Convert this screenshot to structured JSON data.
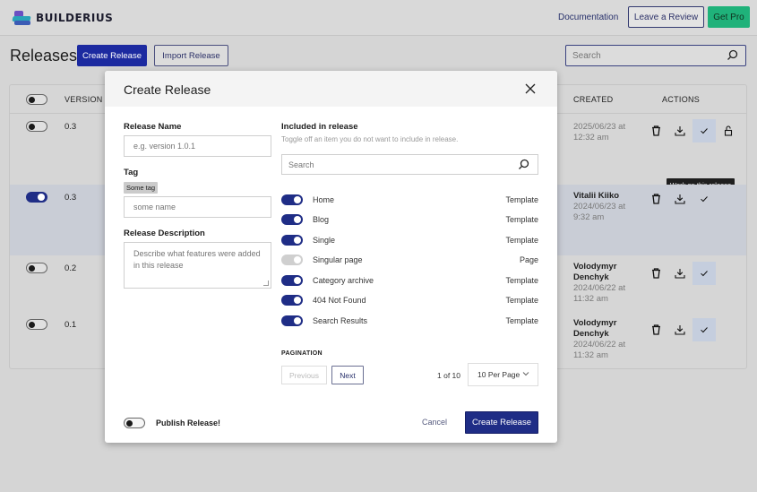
{
  "app": {
    "brand": "BUILDERIUS",
    "nav": {
      "documentation": "Documentation",
      "leave_review": "Leave a Review",
      "get_pro": "Get Pro"
    },
    "colors": {
      "primary": "#1c2aa0",
      "pro_green": "#1fb27a",
      "toggle_on": "#1f2d86"
    }
  },
  "page": {
    "title": "Releases",
    "create_release": "Create Release",
    "import_release": "Import Release",
    "search": {
      "placeholder": "Search",
      "value": ""
    }
  },
  "table": {
    "columns": {
      "version": "VERSION",
      "created": "CREATED",
      "actions": "ACTIONS"
    },
    "rows": [
      {
        "selected": false,
        "version": "0.3",
        "author": "",
        "created": "2025/06/23 at 12:32 am",
        "work_highlight": true,
        "locked_icon": true
      },
      {
        "selected": true,
        "version": "0.3",
        "author": "Vitalii Kiiko",
        "created": "2024/06/23 at 9:32 am",
        "work_highlight": false,
        "locked_icon": false
      },
      {
        "selected": false,
        "version": "0.2",
        "author": "Volodymyr Denchyk",
        "created": "2024/06/22 at 11:32 am",
        "work_highlight": true,
        "locked_icon": false
      },
      {
        "selected": false,
        "version": "0.1",
        "author": "Volodymyr Denchyk",
        "created": "2024/06/22 at 11:32 am",
        "work_highlight": true,
        "locked_icon": false
      }
    ],
    "tooltip": "Work on this release"
  },
  "modal": {
    "title": "Create Release",
    "release_name": {
      "label": "Release Name",
      "placeholder": "e.g. version 1.0.1",
      "value": ""
    },
    "tag": {
      "label": "Tag",
      "chip": "Some tag",
      "placeholder": "some name",
      "value": ""
    },
    "description": {
      "label": "Release Description",
      "placeholder": "Describe what features were added in this release",
      "value": ""
    },
    "included": {
      "label": "Included in release",
      "hint": "Toggle off an item you do not want to include in release.",
      "search_placeholder": "Search",
      "items": [
        {
          "name": "Home",
          "type": "Template",
          "enabled": true
        },
        {
          "name": "Blog",
          "type": "Template",
          "enabled": true
        },
        {
          "name": "Single",
          "type": "Template",
          "enabled": true
        },
        {
          "name": "Singular page",
          "type": "Page",
          "enabled": false
        },
        {
          "name": "Category archive",
          "type": "Template",
          "enabled": true
        },
        {
          "name": "404 Not Found",
          "type": "Template",
          "enabled": true
        },
        {
          "name": "Search Results",
          "type": "Template",
          "enabled": true
        }
      ]
    },
    "pagination": {
      "label": "PAGINATION",
      "previous": "Previous",
      "next": "Next",
      "page_info": "1 of 10",
      "per_page": "10 Per Page"
    },
    "publish_label": "Publish Release!",
    "publish_enabled": false,
    "cancel": "Cancel",
    "submit": "Create Release"
  }
}
